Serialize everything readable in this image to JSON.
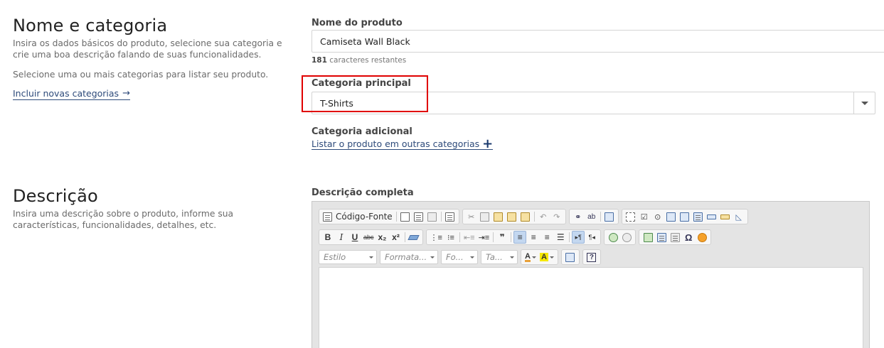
{
  "section1": {
    "title": "Nome e categoria",
    "desc1": "Insira os dados básicos do produto, selecione sua categoria e crie uma boa descrição falando de suas funcionalidades.",
    "desc2": "Selecione uma ou mais categorias para listar seu produto.",
    "link": "Incluir novas categorias"
  },
  "section2": {
    "title": "Descrição",
    "desc": "Insira uma descrição sobre o produto, informe sua características, funcionalidades, detalhes, etc."
  },
  "product_name": {
    "label": "Nome do produto",
    "value": "Camiseta Wall Black",
    "chars_count": "181",
    "chars_text": "caracteres restantes"
  },
  "main_category": {
    "label": "Categoria principal",
    "value": "T-Shirts"
  },
  "extra_category": {
    "label": "Categoria adicional",
    "link": "Listar o produto em outras categorias"
  },
  "full_description": {
    "label": "Descrição completa"
  },
  "editor": {
    "source_label": "Código-Fonte",
    "style_combo": "Estilo",
    "format_combo": "Formata...",
    "font_combo": "Fo...",
    "size_combo": "Ta...",
    "bold": "B",
    "italic": "I",
    "underline": "U",
    "strike": "abc",
    "subscript": "x₂",
    "superscript": "x²",
    "quote": "❞",
    "omega": "Ω",
    "help": "?"
  }
}
